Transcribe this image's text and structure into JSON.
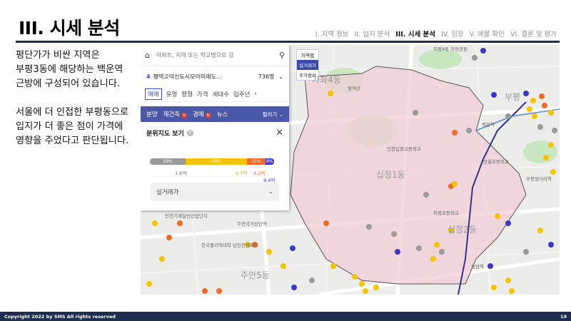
{
  "header": {
    "title": "III. 시세 분석",
    "nav": [
      {
        "label": "I. 지역 정보",
        "active": false
      },
      {
        "label": "II. 입지 분석",
        "active": false
      },
      {
        "label": "III. 시세 분석",
        "active": true
      },
      {
        "label": "IV. 임장",
        "active": false
      },
      {
        "label": "V. 매물 확인",
        "active": false
      },
      {
        "label": "VI. 결론 및 평가",
        "active": false
      }
    ]
  },
  "body": {
    "paragraph1": "평단가가 비싼 지역은 부평3동에 해당하는 백운역 근방에 구성되어 있습니다.",
    "paragraph2": "서울에 더 인접한 부평동으로 입지가 더 좋은 점이 가격에 영향을 주었다고 판단됩니다."
  },
  "panel": {
    "search_placeholder": "아파트, 지역 또는 학교명으로 검",
    "complex_number": "4",
    "complex_name": "평택고덕신도시모아미래도...",
    "complex_count": "736명",
    "tabs": [
      "매매",
      "유형",
      "평형",
      "가격",
      "세대수",
      "입주년"
    ],
    "filters": [
      "분양",
      "재건축",
      "경매",
      "뉴스"
    ],
    "filter_more": "펼치기",
    "dist_title": "분위지도 보기",
    "dist_segments": [
      {
        "label": "29%",
        "percent": 29,
        "color": "#9a9a9a"
      },
      {
        "label": "49%",
        "percent": 49,
        "color": "#f5c400"
      },
      {
        "label": "15%",
        "percent": 15,
        "color": "#f06a28"
      },
      {
        "label": "8%",
        "percent": 7,
        "color": "#4338c8"
      }
    ],
    "price_labels": [
      "1.6억",
      "2.7억",
      "4.2억",
      "8.4억"
    ],
    "select_value": "실거래가"
  },
  "map": {
    "side_buttons": [
      "지역맵",
      "실거래가",
      "주거정보"
    ],
    "labels": {
      "dong1": "십정1동",
      "dong2": "십정2동",
      "dong3": "주안5동",
      "dong4": "가좌4동",
      "dong5": "부평",
      "l1": "부평4동 자연공원",
      "l2": "원적산",
      "l3": "인천십정고등학교",
      "l4": "부평역",
      "l5": "동암역",
      "l6": "백운역",
      "l7": "주안국가산단역",
      "l8": "인천기계일반산업단지",
      "l9": "한국폴리텍대학 남인천캠퍼스",
      "l10": "부평생거리역",
      "l11": "하정초등학교",
      "l12": "만월초등학교"
    },
    "colors": {
      "gray": "#9a9a9a",
      "yellow": "#f5c400",
      "orange": "#f06a28",
      "red": "#e84030",
      "blue": "#3f35c8"
    }
  },
  "footer": {
    "copyright": "Copyright 2022 by SMS All rights reserved",
    "page": "19"
  }
}
